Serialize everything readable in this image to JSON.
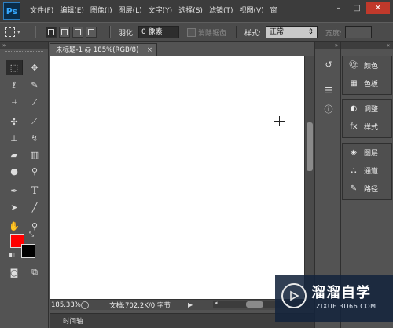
{
  "app": {
    "logo": "Ps"
  },
  "menu": [
    "文件(F)",
    "编辑(E)",
    "图像(I)",
    "图层(L)",
    "文字(Y)",
    "选择(S)",
    "滤镜(T)",
    "视图(V)",
    "窗"
  ],
  "window_controls": {
    "minimize": "–",
    "restore": "□",
    "close": "✕"
  },
  "options": {
    "feather_label": "羽化:",
    "feather_value": "0 像素",
    "antialias_label": "消除锯齿",
    "style_label": "样式:",
    "style_value": "正常",
    "width_label": "宽度:"
  },
  "document": {
    "tab_title": "未标题-1 @ 185%(RGB/8)",
    "tab_close": "×",
    "zoom": "185.33%",
    "doc_info": "文档:702.2K/0 字节",
    "timeline_label": "时间轴"
  },
  "panels": {
    "color": "颜色",
    "swatches": "色板",
    "adjustments": "调整",
    "styles": "样式",
    "layers": "图层",
    "channels": "通道",
    "paths": "路径"
  },
  "collapse_arrows": {
    "left": "«",
    "mid": "»",
    "right": "«"
  },
  "colors": {
    "foreground": "#ff0000",
    "background": "#000000"
  },
  "watermark": {
    "title": "溜溜自学",
    "url": "ZIXUE.3D66.COM"
  }
}
